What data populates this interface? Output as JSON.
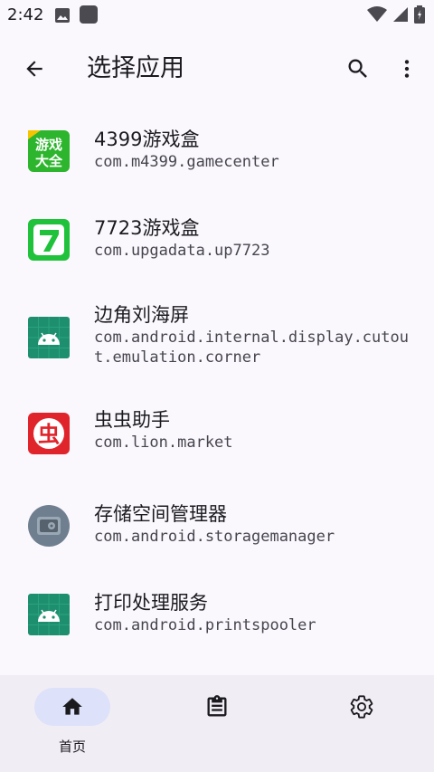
{
  "status_bar": {
    "time": "2:42",
    "icons": [
      "image-icon",
      "square-app-icon",
      "wifi-icon",
      "signal-icon",
      "battery-icon"
    ]
  },
  "app_bar": {
    "title": "选择应用",
    "back_icon": "arrow-back-icon",
    "search_icon": "search-icon",
    "more_icon": "more-vert-icon"
  },
  "apps": [
    {
      "name": "4399游戏盒",
      "package": "com.m4399.gamecenter",
      "icon": "4399-icon",
      "icon_text": "游戏大全"
    },
    {
      "name": "7723游戏盒",
      "package": "com.upgadata.up7723",
      "icon": "7723-icon",
      "icon_text": "7"
    },
    {
      "name": "边角刘海屏",
      "package": "com.android.internal.display.cutout.emulation.corner",
      "icon": "android-robot-icon"
    },
    {
      "name": "虫虫助手",
      "package": "com.lion.market",
      "icon": "chongchong-icon",
      "icon_text": "虫"
    },
    {
      "name": "存储空间管理器",
      "package": "com.android.storagemanager",
      "icon": "storage-manager-icon"
    },
    {
      "name": "打印处理服务",
      "package": "com.android.printspooler",
      "icon": "android-robot-icon"
    }
  ],
  "bottom_nav": {
    "items": [
      {
        "label": "首页",
        "icon": "home-icon",
        "active": true
      },
      {
        "label": "",
        "icon": "clipboard-icon",
        "active": false
      },
      {
        "label": "",
        "icon": "settings-icon",
        "active": false
      }
    ]
  },
  "colors": {
    "background": "#fbf8fd",
    "nav_background": "#f0edf4",
    "active_pill": "#dde1f9",
    "green_4399": "#2db52d",
    "red_chongchong": "#e0242c",
    "android_green": "#1d8f6e"
  }
}
